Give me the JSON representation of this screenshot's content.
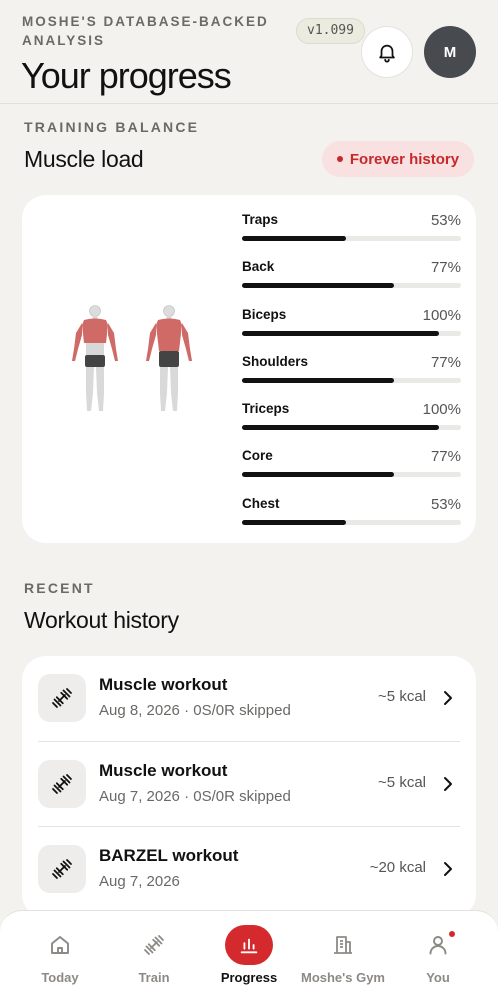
{
  "header": {
    "app_name": "MOSHE'S DATABASE-BACKED ANALYSIS",
    "version": "v1.099",
    "title": "Your progress",
    "avatar_initial": "M"
  },
  "training_balance": {
    "overline": "TRAINING BALANCE",
    "title": "Muscle load",
    "filter": "Forever history",
    "muscles": [
      {
        "name": "Traps",
        "pct_label": "53%",
        "value": 53
      },
      {
        "name": "Back",
        "pct_label": "77%",
        "value": 77
      },
      {
        "name": "Biceps",
        "pct_label": "100%",
        "value": 100
      },
      {
        "name": "Shoulders",
        "pct_label": "77%",
        "value": 77
      },
      {
        "name": "Triceps",
        "pct_label": "100%",
        "value": 100
      },
      {
        "name": "Core",
        "pct_label": "77%",
        "value": 77
      },
      {
        "name": "Chest",
        "pct_label": "53%",
        "value": 53
      }
    ]
  },
  "recent": {
    "overline": "RECENT",
    "title": "Workout history",
    "workouts": [
      {
        "title": "Muscle workout",
        "subtitle": "Aug 8, 2026 · 0S/0R skipped",
        "kcal": "~5 kcal"
      },
      {
        "title": "Muscle workout",
        "subtitle": "Aug 7, 2026 · 0S/0R skipped",
        "kcal": "~5 kcal"
      },
      {
        "title": "BARZEL workout",
        "subtitle": "Aug 7, 2026",
        "kcal": "~20 kcal"
      }
    ]
  },
  "nav": {
    "items": [
      {
        "label": "Today",
        "icon": "home-icon"
      },
      {
        "label": "Train",
        "icon": "dumbbell-icon"
      },
      {
        "label": "Progress",
        "icon": "bar-chart-icon",
        "active": true
      },
      {
        "label": "Moshe's Gym",
        "icon": "building-icon"
      },
      {
        "label": "You",
        "icon": "person-icon",
        "badge": true
      }
    ]
  },
  "colors": {
    "accent": "#d52a2d",
    "bar_fill": "#121212",
    "muscle_highlight": "#cf6a66",
    "background": "#f4f2ef"
  }
}
